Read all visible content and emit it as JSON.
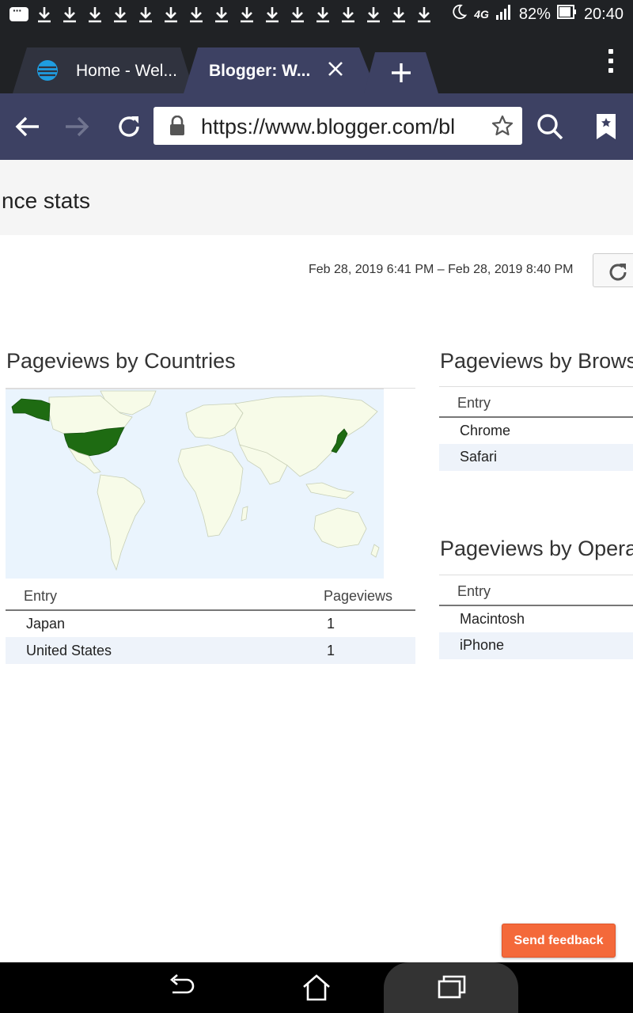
{
  "status_bar": {
    "battery": "82%",
    "time": "20:40",
    "network": "4G"
  },
  "tabs": [
    {
      "label": "Home - Wel...",
      "icon": "att-globe-icon"
    },
    {
      "label": "Blogger: W...",
      "active": true
    }
  ],
  "toolbar": {
    "url": "https://www.blogger.com/bl"
  },
  "page": {
    "title": "nce stats",
    "date_range": "Feb 28, 2019 6:41 PM – Feb 28, 2019 8:40 PM"
  },
  "countries": {
    "title": "Pageviews by Countries",
    "header_entry": "Entry",
    "header_pageviews": "Pageviews",
    "rows": [
      {
        "entry": "Japan",
        "pageviews": "1"
      },
      {
        "entry": "United States",
        "pageviews": "1"
      }
    ],
    "highlight_color": "#1e6b12"
  },
  "browsers": {
    "title": "Pageviews by Brows",
    "header_entry": "Entry",
    "rows": [
      {
        "entry": "Chrome"
      },
      {
        "entry": "Safari"
      }
    ]
  },
  "os": {
    "title": "Pageviews by Opera",
    "header_entry": "Entry",
    "rows": [
      {
        "entry": "Macintosh"
      },
      {
        "entry": "iPhone"
      }
    ]
  },
  "feedback": {
    "label": "Send feedback",
    "color": "#f4693a"
  },
  "colors": {
    "toolbar": "#3d4163",
    "tabstrip": "#202225"
  }
}
